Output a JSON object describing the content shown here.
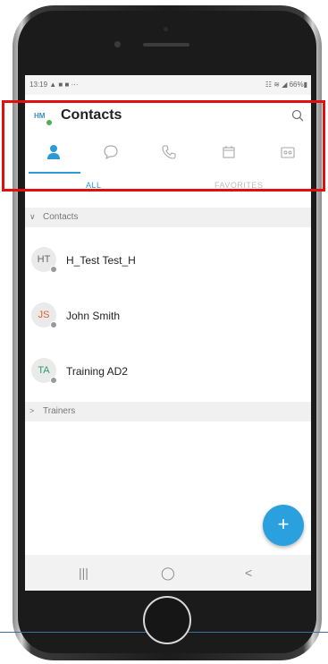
{
  "status_bar": {
    "left": "13:19 ▲ ■ ■ ···",
    "right": "☷ ≋ ◢ 66%▮"
  },
  "app_bar": {
    "avatar_initials": "HM",
    "title": "Contacts"
  },
  "tabs": [
    {
      "name": "contacts",
      "icon": "person-icon",
      "active": true
    },
    {
      "name": "chat",
      "icon": "chat-bubble-icon",
      "active": false
    },
    {
      "name": "calls",
      "icon": "phone-icon",
      "active": false
    },
    {
      "name": "meetings",
      "icon": "calendar-icon",
      "active": false
    },
    {
      "name": "voicemail",
      "icon": "voicemail-icon",
      "active": false
    }
  ],
  "sub_tabs": {
    "all": "ALL",
    "favorites": "FAVORITES"
  },
  "sections": {
    "contacts": {
      "chevron": "∨",
      "label": "Contacts"
    },
    "trainers": {
      "chevron": ">",
      "label": "Trainers"
    }
  },
  "contacts": [
    {
      "initials": "HT",
      "name": "H_Test Test_H",
      "color": "#666666"
    },
    {
      "initials": "JS",
      "name": "John Smith",
      "color": "#e0602a"
    },
    {
      "initials": "TA",
      "name": "Training AD2",
      "color": "#2a9e6a"
    }
  ],
  "fab": {
    "label": "+"
  },
  "nav": {
    "recents": "|||",
    "home": "◯",
    "back": "<"
  },
  "colors": {
    "accent": "#2a9bd6",
    "fab": "#2aa0df",
    "highlight": "#e01010"
  }
}
